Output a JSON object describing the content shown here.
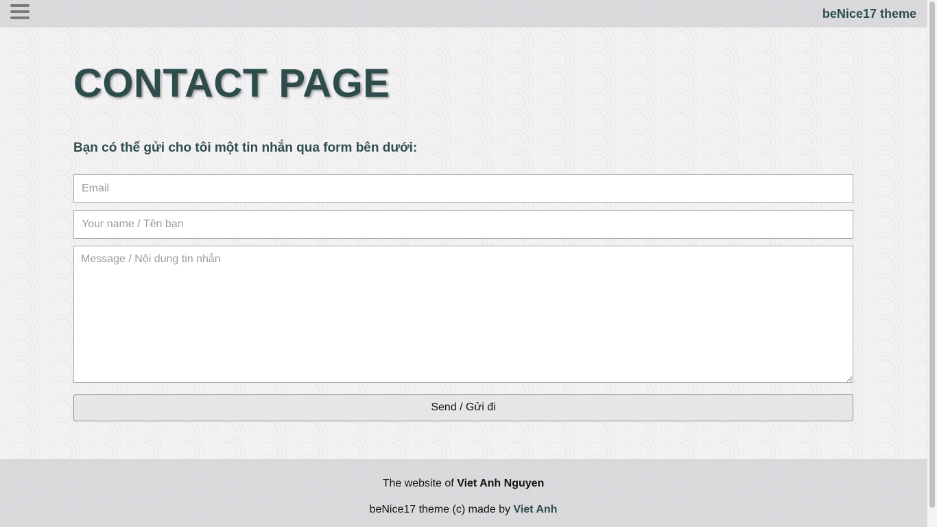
{
  "header": {
    "menu_icon": "hamburger-menu-icon",
    "brand": "beNice17 theme"
  },
  "main": {
    "title": "CONTACT PAGE",
    "intro": "Bạn có thể gửi cho tôi một tin nhắn qua form bên dưới:",
    "form": {
      "email_placeholder": "Email",
      "email_value": "",
      "name_placeholder": "Your name / Tên bạn",
      "name_value": "",
      "message_placeholder": "Message / Nội dung tin nhắn",
      "message_value": "",
      "send_label": "Send / Gửi đi"
    }
  },
  "footer": {
    "line1_prefix": "The website of ",
    "line1_name": "Viet Anh Nguyen",
    "line2_prefix": "beNice17 theme (c) made by ",
    "line2_link": "Viet Anh"
  },
  "colors": {
    "accent": "#2e4d4a",
    "bar_background": "#d2d2d6",
    "page_background": "#f2f2f3"
  }
}
